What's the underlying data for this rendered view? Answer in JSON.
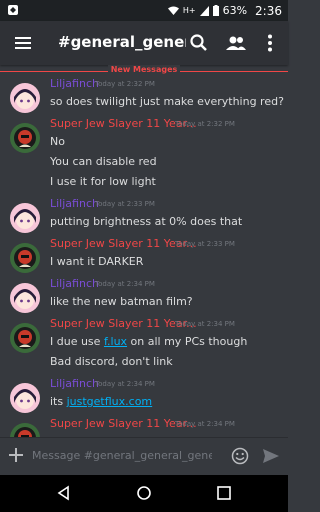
{
  "status": {
    "battery": "63%",
    "time": "2:36",
    "network": "H+"
  },
  "header": {
    "title": "#general_general..."
  },
  "divider": {
    "label": "New Messages"
  },
  "messages": [
    {
      "author": "Liljafinch",
      "time": "Today at 2:32 PM",
      "lines": [
        "so does twilight just make everything red?"
      ],
      "avatar": "pink"
    },
    {
      "author": "Super Jew Slayer 11 Year...",
      "time": "Today at 2:32 PM",
      "lines": [
        "No",
        "You can disable red",
        "I use it for low light"
      ],
      "avatar": "red"
    },
    {
      "author": "Liljafinch",
      "time": "Today at 2:33 PM",
      "lines": [
        "putting brightness at 0% does that"
      ],
      "avatar": "pink"
    },
    {
      "author": "Super Jew Slayer 11 Year...",
      "time": "Today at 2:33 PM",
      "lines": [
        "I want it DARKER"
      ],
      "avatar": "red"
    },
    {
      "author": "Liljafinch",
      "time": "Today at 2:34 PM",
      "lines": [
        "like the new batman film?"
      ],
      "avatar": "pink"
    },
    {
      "author": "Super Jew Slayer 11 Year...",
      "time": "Today at 2:34 PM",
      "lines": [
        "I due use |f.lux| on all my PCs though",
        "Bad discord, don't link"
      ],
      "avatar": "red"
    },
    {
      "author": "Liljafinch",
      "time": "Today at 2:34 PM",
      "lines": [
        "its |justgetflux.com|"
      ],
      "avatar": "pink"
    },
    {
      "author": "Super Jew Slayer 11 Year...",
      "time": "Today at 2:34 PM",
      "lines": [],
      "avatar": "red"
    }
  ],
  "input": {
    "placeholder": "Message #general_general_general"
  },
  "colors": {
    "author_purple": "#7a4dd6",
    "author_red": "#f04747",
    "link": "#00b0f4",
    "bg": "#36393e"
  }
}
